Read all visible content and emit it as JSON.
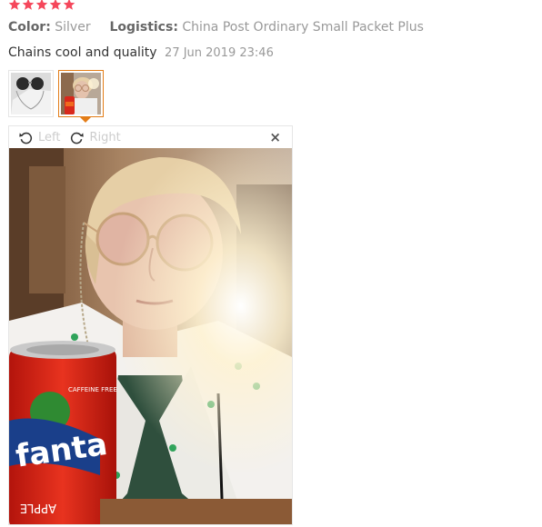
{
  "rating": {
    "stars": 5,
    "max_stars": 5,
    "star_color": "#f5475b"
  },
  "meta": {
    "color_label": "Color:",
    "color_value": "Silver",
    "logistics_label": "Logistics:",
    "logistics_value": "China Post Ordinary Small Packet Plus"
  },
  "review": {
    "text": "Chains cool and quality",
    "date": "27 Jun 2019 23:46"
  },
  "thumbnails": [
    {
      "name": "sunglasses-product-photo",
      "selected": false
    },
    {
      "name": "selfie-photo",
      "selected": true
    }
  ],
  "viewer": {
    "rotate_left_label": "Left",
    "rotate_right_label": "Right",
    "close_label": "×",
    "can_label": "fanta",
    "can_small_text": "CAFFEINE FREE",
    "can_bottom_text": "APPLE"
  },
  "colors": {
    "accent": "#e37d18",
    "muted_text": "#999999",
    "body_text": "#333333"
  }
}
